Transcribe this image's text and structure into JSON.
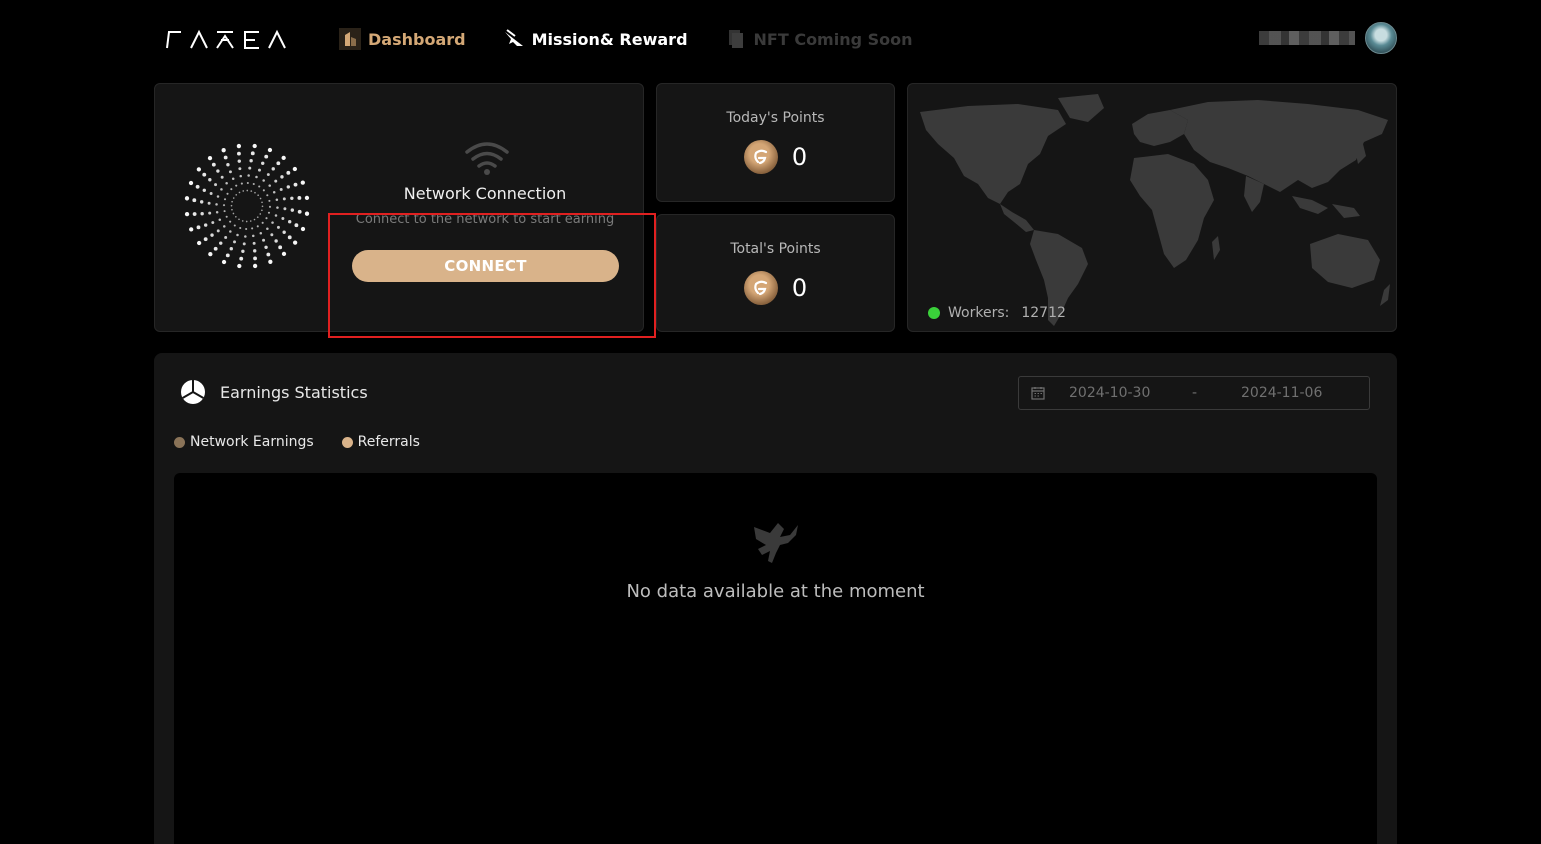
{
  "header": {
    "logo_text": "GAIEA",
    "nav": [
      {
        "label": "Dashboard",
        "active": true
      },
      {
        "label": "Mission& Reward",
        "active": false
      },
      {
        "label": "NFT Coming Soon",
        "active": false,
        "disabled": true
      }
    ]
  },
  "network": {
    "title": "Network Connection",
    "subtitle": "Connect to the network to start earning",
    "button": "CONNECT"
  },
  "points": {
    "today_label": "Today's Points",
    "today_value": "0",
    "total_label": "Total's Points",
    "total_value": "0"
  },
  "map": {
    "workers_label": "Workers:",
    "workers_value": "12712"
  },
  "earnings": {
    "title": "Earnings Statistics",
    "date_start": "2024-10-30",
    "date_sep": "-",
    "date_end": "2024-11-06",
    "legend": [
      {
        "label": "Network Earnings",
        "color": "#8a7358"
      },
      {
        "label": "Referrals",
        "color": "#d9b38a"
      }
    ],
    "empty_text": "No data available at the moment"
  },
  "colors": {
    "accent": "#d9b38a",
    "dashboard_active": "#d4a876",
    "highlight_border": "#e02020",
    "online": "#3ad13a"
  }
}
